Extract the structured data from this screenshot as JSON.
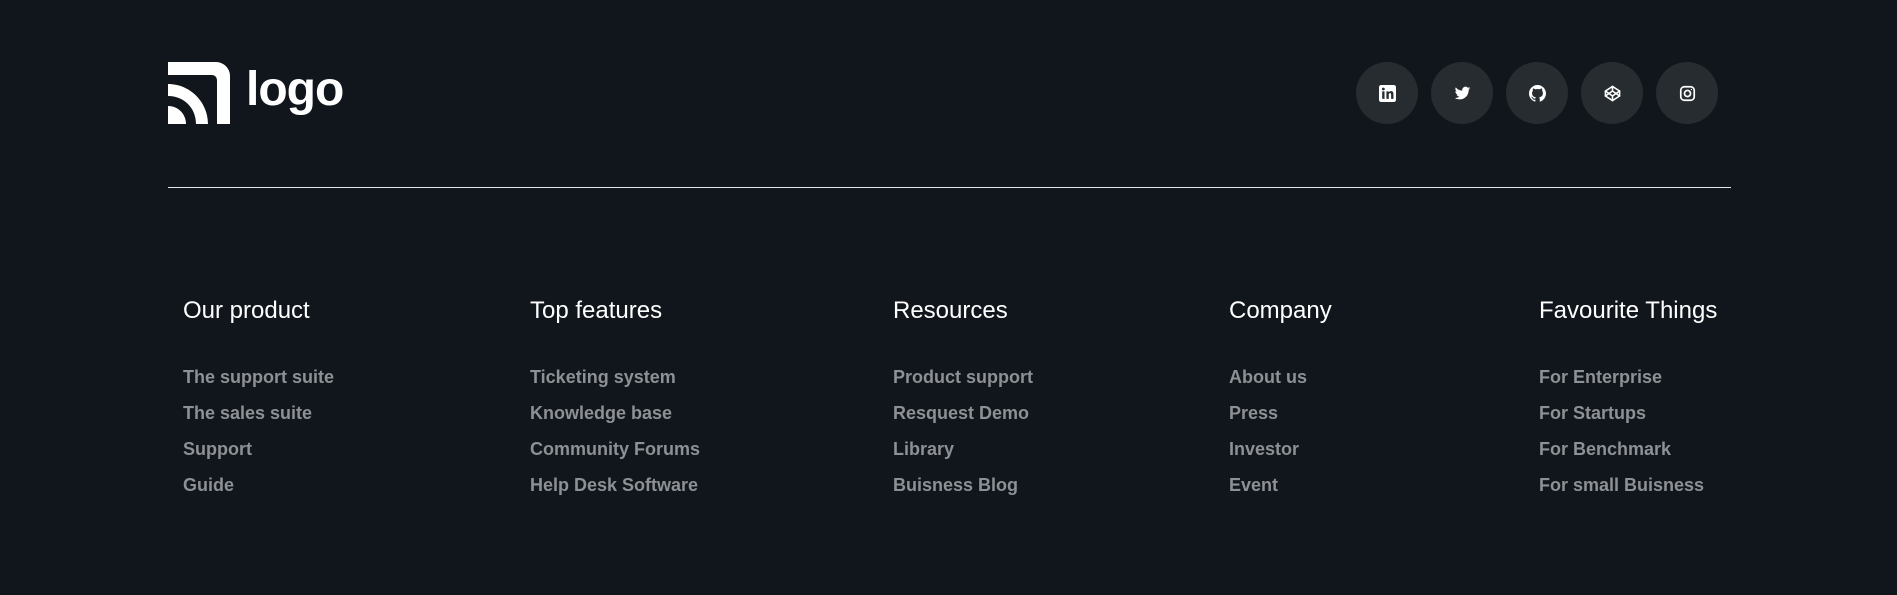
{
  "brand": {
    "name": "logo"
  },
  "socials": [
    {
      "icon": "linkedin-icon",
      "label": "LinkedIn"
    },
    {
      "icon": "twitter-icon",
      "label": "Twitter"
    },
    {
      "icon": "github-icon",
      "label": "GitHub"
    },
    {
      "icon": "codepen-icon",
      "label": "CodePen"
    },
    {
      "icon": "instagram-icon",
      "label": "Instagram"
    }
  ],
  "columns": [
    {
      "title": "Our product",
      "links": [
        "The support suite",
        "The sales suite",
        "Support",
        "Guide"
      ]
    },
    {
      "title": "Top features",
      "links": [
        "Ticketing system",
        "Knowledge base",
        "Community Forums",
        "Help Desk Software"
      ]
    },
    {
      "title": "Resources",
      "links": [
        "Product support",
        "Resquest Demo",
        "Library",
        "Buisness Blog"
      ]
    },
    {
      "title": "Company",
      "links": [
        "About us",
        "Press",
        "Investor",
        "Event"
      ]
    },
    {
      "title": "Favourite Things",
      "links": [
        "For Enterprise",
        "For Startups",
        "For Benchmark",
        "For small Buisness"
      ]
    }
  ],
  "colors": {
    "background": "#10161b",
    "social_bg": "#262c30",
    "link": "#8d9094",
    "heading": "#ffffff"
  }
}
